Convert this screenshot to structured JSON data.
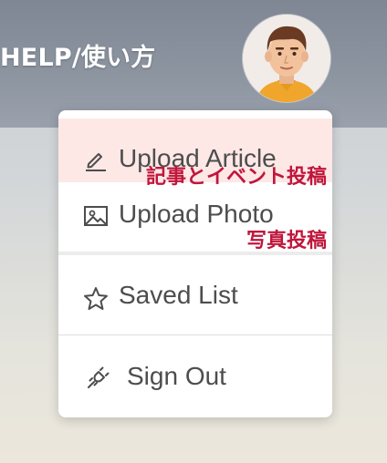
{
  "header": {
    "help_label": "HELP/使い方",
    "avatar_icon": "user-avatar"
  },
  "menu": {
    "items": [
      {
        "label": "Upload Article",
        "icon": "pencil-icon"
      },
      {
        "label": "Upload Photo",
        "icon": "image-icon"
      },
      {
        "label": "Saved List",
        "icon": "star-icon"
      },
      {
        "label": "Sign Out",
        "icon": "plug-icon"
      }
    ],
    "highlight_color": "#fde8e6"
  },
  "annotations": {
    "upload_article_note": "記事とイベント投稿",
    "upload_photo_note": "写真投稿",
    "color": "#c0163c"
  }
}
